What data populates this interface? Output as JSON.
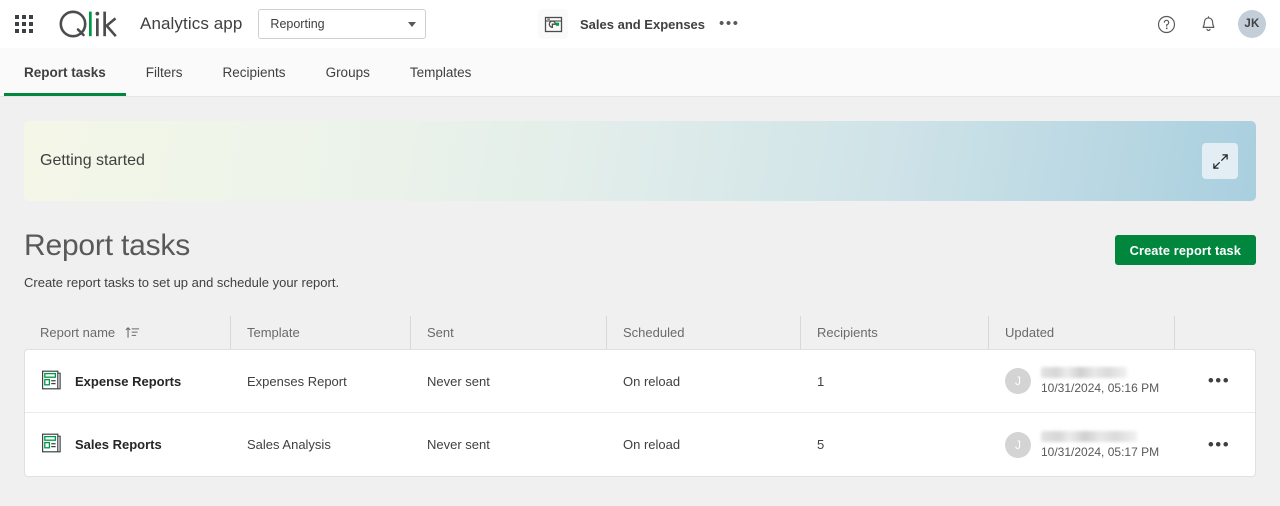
{
  "topbar": {
    "waffle_icon": "apps-grid-icon",
    "logo": "qlik-logo",
    "app_title": "Analytics app",
    "space_selector": {
      "value": "Reporting",
      "icon": "chevron-down-icon"
    },
    "document": {
      "icon": "sheet-chart-icon",
      "name": "Sales and Expenses",
      "more_label": "•••"
    },
    "help_icon": "help-circle-icon",
    "notifications_icon": "bell-icon",
    "avatar_initials": "JK"
  },
  "tabs": [
    {
      "label": "Report tasks",
      "active": true
    },
    {
      "label": "Filters",
      "active": false
    },
    {
      "label": "Recipients",
      "active": false
    },
    {
      "label": "Groups",
      "active": false
    },
    {
      "label": "Templates",
      "active": false
    }
  ],
  "banner": {
    "title": "Getting started",
    "expand_icon": "expand-diagonal-icon"
  },
  "page": {
    "title": "Report tasks",
    "subtitle": "Create report tasks to set up and schedule your report.",
    "create_button": "Create report task"
  },
  "table": {
    "columns": [
      {
        "key": "report_name",
        "label": "Report name",
        "sort_icon": "sort-ascending-icon",
        "sorted": true
      },
      {
        "key": "template",
        "label": "Template"
      },
      {
        "key": "sent",
        "label": "Sent"
      },
      {
        "key": "scheduled",
        "label": "Scheduled"
      },
      {
        "key": "recipients",
        "label": "Recipients"
      },
      {
        "key": "updated",
        "label": "Updated"
      }
    ],
    "rows": [
      {
        "icon": "report-document-icon",
        "report_name": "Expense Reports",
        "template": "Expenses Report",
        "sent": "Never sent",
        "scheduled": "On reload",
        "recipients": "1",
        "updated_avatar": "J",
        "updated_user": "",
        "updated_date": "10/31/2024, 05:16 PM",
        "actions_label": "•••"
      },
      {
        "icon": "report-document-icon",
        "report_name": "Sales Reports",
        "template": "Sales Analysis",
        "sent": "Never sent",
        "scheduled": "On reload",
        "recipients": "5",
        "updated_avatar": "J",
        "updated_user": "",
        "updated_date": "10/31/2024, 05:17 PM",
        "actions_label": "•••"
      }
    ]
  },
  "colors": {
    "brand_green": "#00873d",
    "page_bg": "#f0f0f0",
    "text_primary": "#404040",
    "text_muted": "#6a6a6a",
    "avatar_bg": "#c3ced9"
  }
}
